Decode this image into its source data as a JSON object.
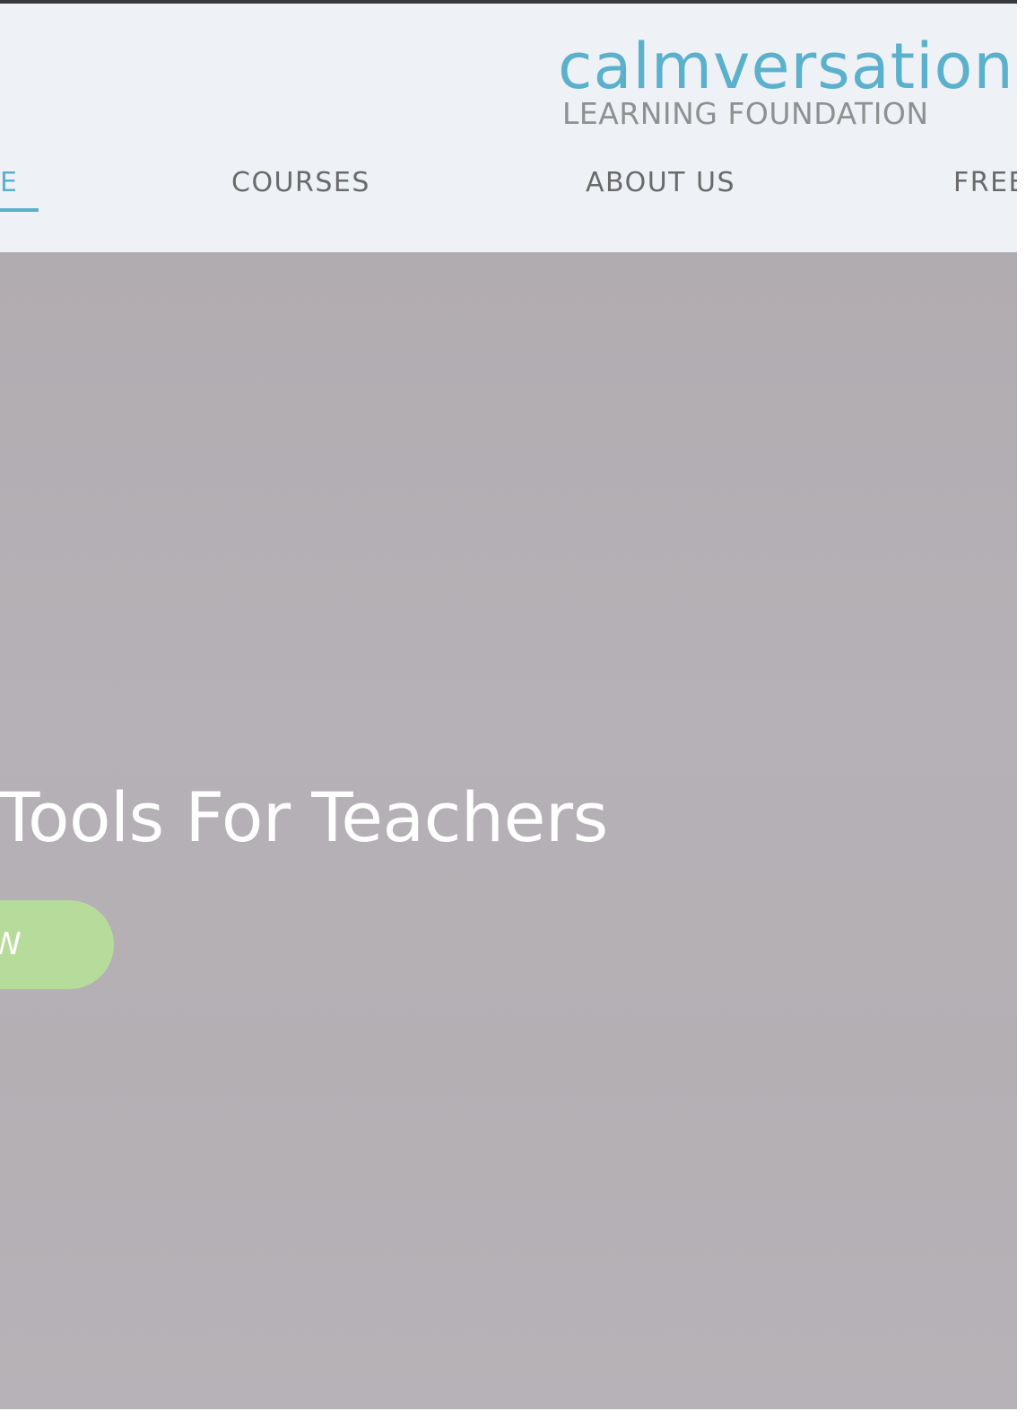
{
  "header": {
    "logo": {
      "wordmark": "calmversation",
      "trademark": "™",
      "subtitle": "LEARNING FOUNDATION"
    },
    "nav": {
      "items": [
        {
          "label": "E",
          "active": true
        },
        {
          "label": "COURSES",
          "active": false
        },
        {
          "label": "ABOUT US",
          "active": false
        },
        {
          "label": "FREE",
          "active": false
        }
      ]
    }
  },
  "hero": {
    "title": "Tools For Teachers",
    "button_label": "W"
  },
  "colors": {
    "brand_blue": "#5bb1cc",
    "nav_gray": "#6a6a6a",
    "logo_gray": "#909090",
    "header_bg": "#eef2f7",
    "hero_bg": "#b3afb3",
    "button_green": "#b6dc9b"
  }
}
